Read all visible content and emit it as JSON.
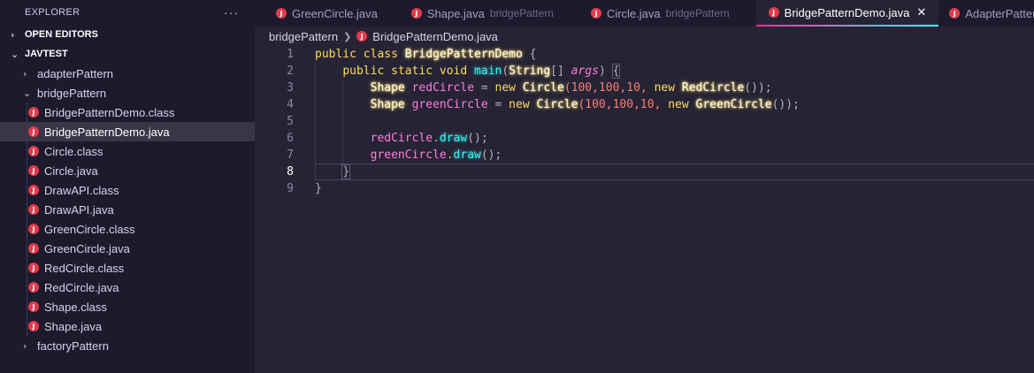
{
  "explorer": {
    "title": "EXPLORER",
    "more": "···",
    "open_editors": "OPEN EDITORS",
    "project": "JAVTEST",
    "folders": {
      "adapter": "adapterPattern",
      "bridge": "bridgePattern",
      "factory": "factoryPattern"
    },
    "files": [
      "BridgePatternDemo.class",
      "BridgePatternDemo.java",
      "Circle.class",
      "Circle.java",
      "DrawAPI.class",
      "DrawAPI.java",
      "GreenCircle.class",
      "GreenCircle.java",
      "RedCircle.class",
      "RedCircle.java",
      "Shape.class",
      "Shape.java"
    ]
  },
  "tabs": [
    {
      "label": "GreenCircle.java",
      "desc": ""
    },
    {
      "label": "Shape.java",
      "desc": "bridgePattern"
    },
    {
      "label": "Circle.java",
      "desc": "bridgePattern"
    },
    {
      "label": "BridgePatternDemo.java",
      "desc": ""
    },
    {
      "label": "AdapterPatternDemo.java",
      "desc": ""
    }
  ],
  "tab_close": "✕",
  "breadcrumb": {
    "folder": "bridgePattern",
    "file": "BridgePatternDemo.java"
  },
  "editor": {
    "line_numbers": [
      "1",
      "2",
      "3",
      "4",
      "5",
      "6",
      "7",
      "8",
      "9"
    ],
    "current_line": 8,
    "code": {
      "l1_public": "public",
      "l1_class": "class",
      "l1_name": "BridgePatternDemo",
      "l1_brace": "{",
      "l2_public": "public",
      "l2_static": "static",
      "l2_void": "void",
      "l2_main": "main",
      "l2_open": "(",
      "l2_string": "String",
      "l2_arr": "[]",
      "l2_args": "args",
      "l2_close": ")",
      "l2_brace": "{",
      "l3_shape": "Shape",
      "l3_var": "redCircle",
      "l3_eq": "=",
      "l3_new": "new",
      "l3_circle": "Circle",
      "l3_args": "(100,100,10,",
      "l3_new2": "new",
      "l3_red": "RedCircle",
      "l3_end": "());",
      "l4_shape": "Shape",
      "l4_var": "greenCircle",
      "l4_eq": "=",
      "l4_new": "new",
      "l4_circle": "Circle",
      "l4_args": "(100,100,10,",
      "l4_new2": "new",
      "l4_green": "GreenCircle",
      "l4_end": "());",
      "l6_var": "redCircle",
      "l6_dot": ".",
      "l6_draw": "draw",
      "l6_end": "();",
      "l7_var": "greenCircle",
      "l7_dot": ".",
      "l7_draw": "draw",
      "l7_end": "();",
      "l8_brace": "}",
      "l9_brace": "}"
    }
  },
  "colors": {
    "background": "#262335",
    "sidebar": "#1e1a2e",
    "keyword": "#fede5d",
    "variable": "#ff7edb",
    "function": "#36f9f6",
    "number": "#f97e72",
    "java_icon": "#e23b4a"
  }
}
